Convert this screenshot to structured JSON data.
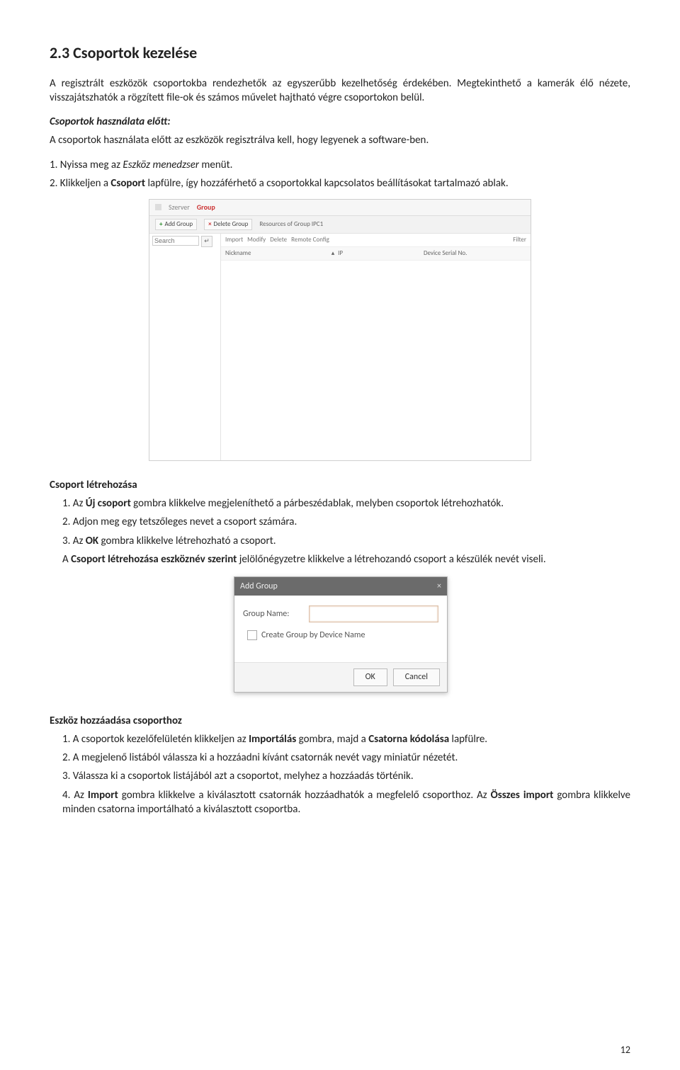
{
  "heading": "2.3 Csoportok kezelése",
  "intro1": "A regisztrált eszközök csoportokba rendezhetők az egyszerűbb kezelhetőség érdekében. Megtekinthető a kamerák élő nézete, visszajátszhatók a rögzített file-ok és számos művelet hajtható végre csoportokon belül.",
  "before_use_title": "Csoportok használata előtt:",
  "before_use_text": "A csoportok használata előtt az eszközök regisztrálva kell, hogy legyenek a software-ben.",
  "step1_prefix": "1. Nyissa meg az ",
  "step1_italic": "Eszköz menedzser",
  "step1_suffix": " menüt.",
  "step2_prefix": "2. Klikkeljen a ",
  "step2_bold": "Csoport",
  "step2_suffix": " lapfülre, így hozzáférhető a csoportokkal kapcsolatos beállításokat tartalmazó ablak.",
  "shot1": {
    "tab_server": "Szerver",
    "tab_group": "Group",
    "btn_add_group": "Add Group",
    "btn_delete_group": "Delete Group",
    "resources_label": "Resources of Group IPC1",
    "search_placeholder": "Search",
    "actions": {
      "import": "Import",
      "modify": "Modify",
      "delete": "Delete",
      "remote": "Remote Config",
      "filter": "Filter"
    },
    "headers": {
      "nickname": "Nickname",
      "ip": "IP",
      "serial": "Device Serial No."
    }
  },
  "create_title": "Csoport létrehozása",
  "create_1_prefix": "1. Az ",
  "create_1_bold": "Új csoport",
  "create_1_suffix": " gombra klikkelve megjeleníthető a párbeszédablak, melyben csoportok létrehozhatók.",
  "create_2": "2. Adjon meg egy tetszőleges nevet a csoport számára.",
  "create_3_prefix": "3. Az ",
  "create_3_bold1": "OK",
  "create_3_mid": " gombra klikkelve létrehozható a csoport.",
  "create_3_line2_prefix": "A ",
  "create_3_bold2": "Csoport létrehozása eszköznév szerint",
  "create_3_line2_suffix": " jelölőnégyzetre klikkelve a létrehozandó csoport a készülék nevét viseli.",
  "shot2": {
    "title": "Add Group",
    "label_name": "Group Name:",
    "checkbox_label": "Create Group by Device Name",
    "ok": "OK",
    "cancel": "Cancel"
  },
  "add_title": "Eszköz hozzáadása csoporthoz",
  "add_1_prefix": "1. A csoportok kezelőfelületén klikkeljen az ",
  "add_1_bold1": "Importálás",
  "add_1_mid": " gombra, majd a ",
  "add_1_bold2": "Csatorna kódolása",
  "add_1_suffix": " lapfülre.",
  "add_2": "2. A megjelenő listából válassza ki a hozzáadni kívánt csatornák nevét vagy miniatűr nézetét.",
  "add_3": "3. Válassza ki a csoportok listájából azt a csoportot, melyhez a hozzáadás történik.",
  "add_4_prefix": "4. Az ",
  "add_4_bold1": "Import",
  "add_4_mid": " gombra klikkelve a kiválasztott csatornák hozzáadhatók a megfelelő csoporthoz. Az ",
  "add_4_bold2": "Összes import",
  "add_4_suffix": " gombra klikkelve minden csatorna importálható a kiválasztott csoportba.",
  "page_number": "12"
}
